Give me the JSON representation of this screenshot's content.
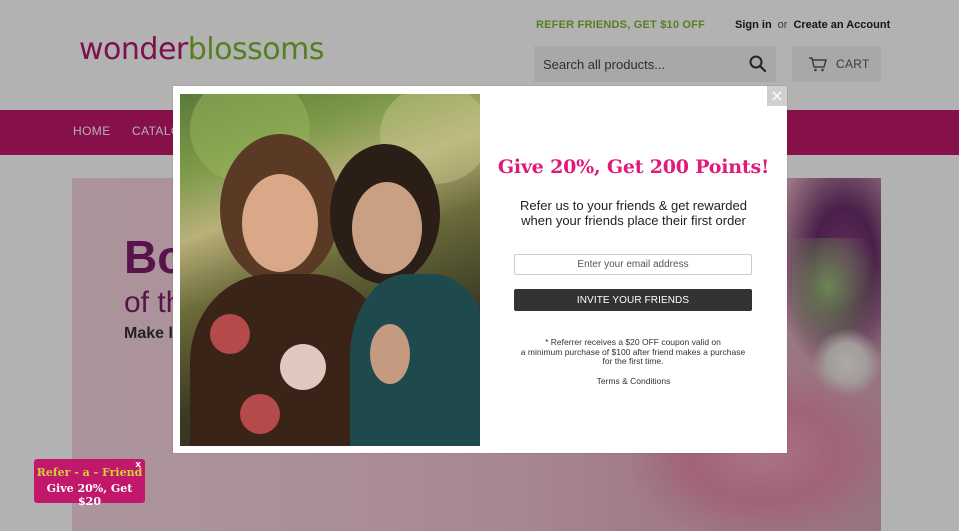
{
  "header": {
    "logo_part1": "wonder",
    "logo_part2": "blossoms",
    "refer_link": "REFER FRIENDS, GET $10 OFF",
    "sign_in": "Sign in",
    "or": "or",
    "create_account": "Create an Account",
    "search_placeholder": "Search all products...",
    "cart_label": "CART"
  },
  "nav": {
    "items": [
      "HOME",
      "CATALOG"
    ]
  },
  "hero": {
    "title": "Bo",
    "subtitle": "of th",
    "small": "Make l"
  },
  "badge": {
    "line1": "Refer - a - Friend",
    "line2": "Give 20%, Get $20",
    "close": "x"
  },
  "modal": {
    "close": "×",
    "title": "Give 20%, Get 200 Points!",
    "desc_line1": "Refer us to your friends & get rewarded",
    "desc_line2": "when your friends place their first order",
    "email_placeholder": "Enter your email address",
    "invite_button": "INVITE YOUR FRIENDS",
    "fine_line1": "* Referrer receives a $20 OFF coupon valid on",
    "fine_line2": "a minimum purchase of $100 after friend makes a purchase",
    "fine_line3": "for the first time.",
    "terms": "Terms & Conditions"
  },
  "colors": {
    "brand_pink": "#c2186b",
    "brand_green": "#7cb82f",
    "modal_title": "#e01a7a"
  }
}
